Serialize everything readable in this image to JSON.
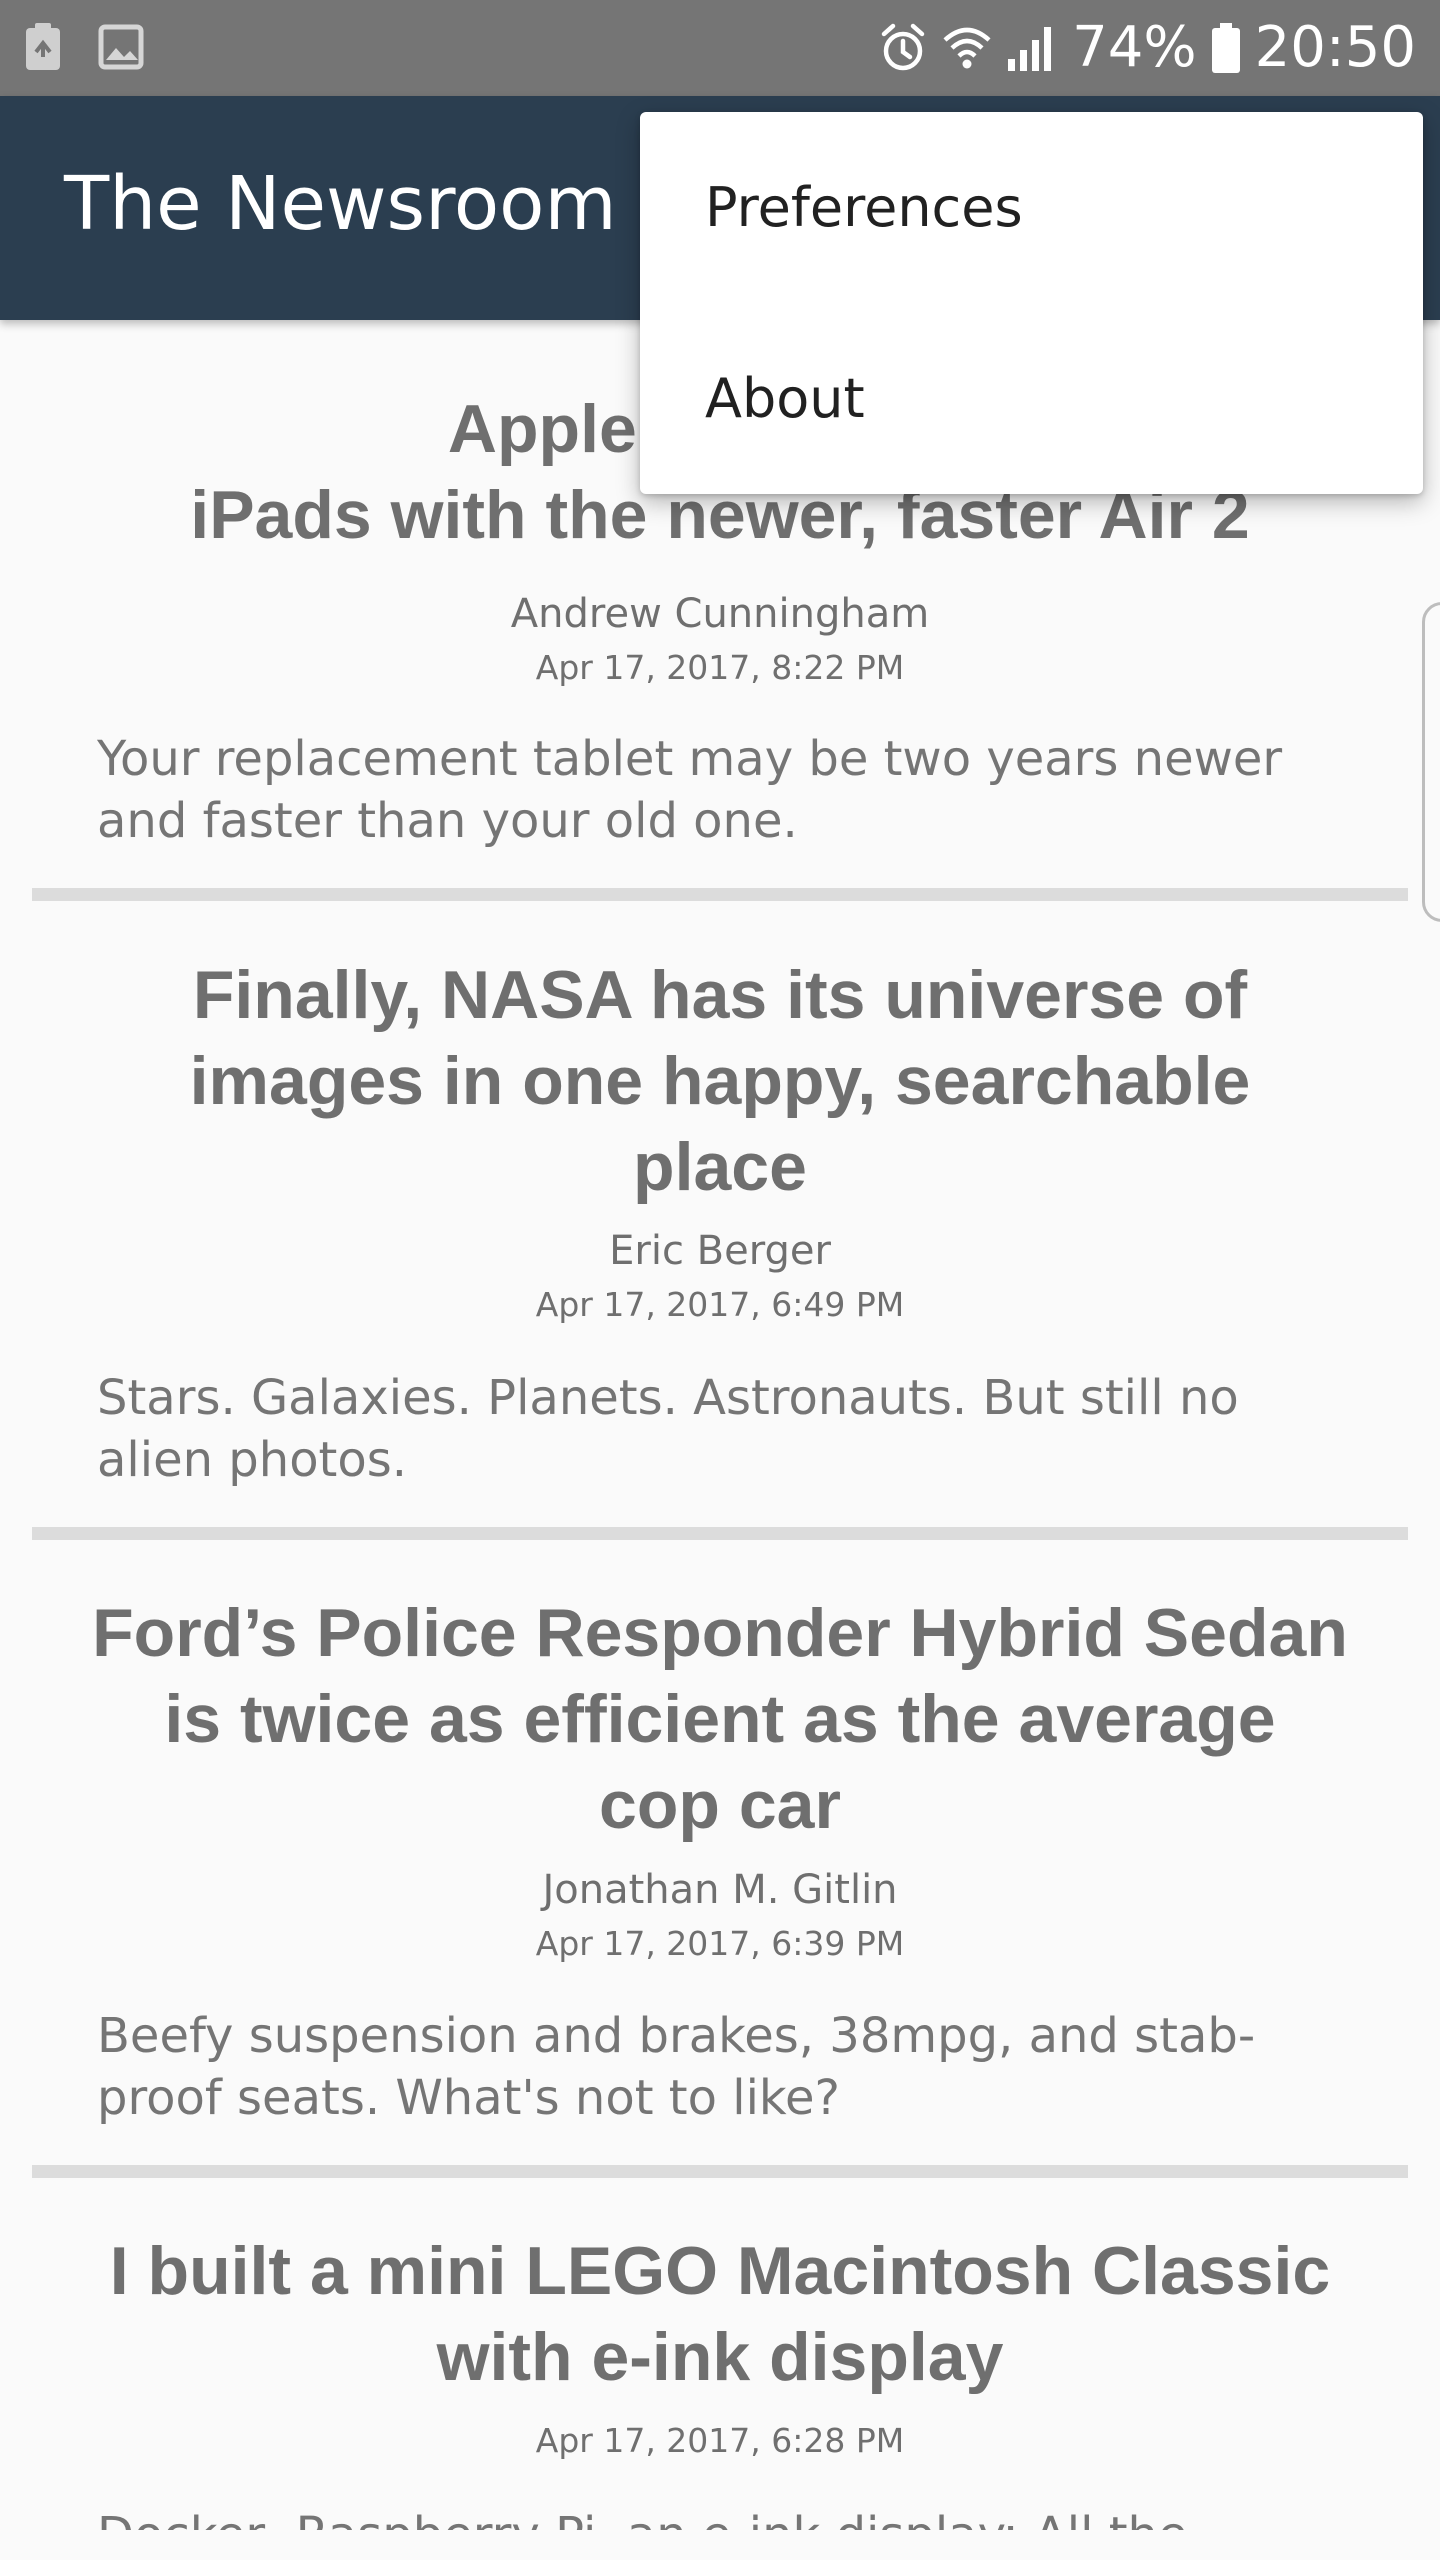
{
  "status_bar": {
    "icons_left": [
      "battery-saver-icon",
      "image-icon"
    ],
    "icons_right": [
      "alarm-icon",
      "wifi-icon",
      "signal-icon",
      "battery-icon"
    ],
    "battery_percent": "74%",
    "time": "20:50"
  },
  "app_bar": {
    "title": "The Newsroom",
    "color": "#2b3e50"
  },
  "menu": {
    "items": [
      {
        "label": "Preferences"
      },
      {
        "label": "About"
      }
    ]
  },
  "articles": [
    {
      "headline_lines": [
        "Apple is replacin",
        "iPads with the newer, faster Air 2"
      ],
      "author": "Andrew Cunningham",
      "date": "Apr 17, 2017, 8:22 PM",
      "summary": "Your replacement tablet may be two years newer and faster than your old one."
    },
    {
      "headline_lines": [
        "Finally, NASA has its universe of",
        "images in one happy, searchable",
        "place"
      ],
      "author": "Eric Berger",
      "date": "Apr 17, 2017, 6:49 PM",
      "summary": "Stars. Galaxies. Planets. Astronauts. But still no alien photos."
    },
    {
      "headline_lines": [
        "Ford’s Police Responder Hybrid Sedan",
        "is twice as efficient as the average",
        "cop car"
      ],
      "author": "Jonathan M. Gitlin",
      "date": "Apr 17, 2017, 6:39 PM",
      "summary": "Beefy suspension and brakes, 38mpg, and stab-proof seats. What's not to like?"
    },
    {
      "headline_lines": [
        "I built a mini LEGO Macintosh Classic",
        "with e-ink display"
      ],
      "author": "",
      "date": "Apr 17, 2017, 6:28 PM",
      "summary": "Docker, Raspberry Pi, an e-ink display: All the"
    }
  ]
}
